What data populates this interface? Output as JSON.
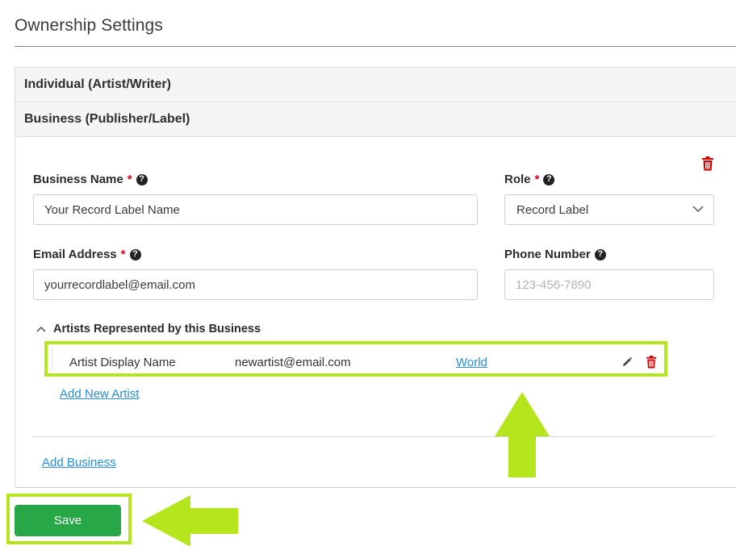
{
  "page": {
    "title": "Ownership Settings"
  },
  "accordion": {
    "sections": [
      {
        "label": "Individual (Artist/Writer)"
      },
      {
        "label": "Business (Publisher/Label)"
      }
    ]
  },
  "business_form": {
    "business_name": {
      "label": "Business Name",
      "required_mark": "*",
      "value": "Your Record Label Name"
    },
    "role": {
      "label": "Role",
      "required_mark": "*",
      "selected": "Record Label"
    },
    "email": {
      "label": "Email Address",
      "required_mark": "*",
      "value": "yourrecordlabel@email.com"
    },
    "phone": {
      "label": "Phone Number",
      "placeholder": "123-456-7890"
    },
    "help_glyph": "?"
  },
  "artists": {
    "section_label": "Artists Represented by this Business",
    "rows": [
      {
        "name": "Artist Display Name",
        "email": "newartist@email.com",
        "territory": "World"
      }
    ],
    "add_artist_label": "Add New Artist"
  },
  "footer": {
    "add_business_label": "Add Business",
    "save_label": "Save"
  },
  "colors": {
    "highlight": "#b5e61d",
    "save_button": "#27a745",
    "link": "#2a8dd4",
    "delete_icon": "#cc0000",
    "required_mark": "#d0021b"
  },
  "icons": {
    "help": "question-circle-icon",
    "delete": "trash-icon",
    "edit": "pencil-icon",
    "select": "chevron-down-icon",
    "toggle": "chevron-up-icon",
    "annotation": "arrow-annotation"
  }
}
